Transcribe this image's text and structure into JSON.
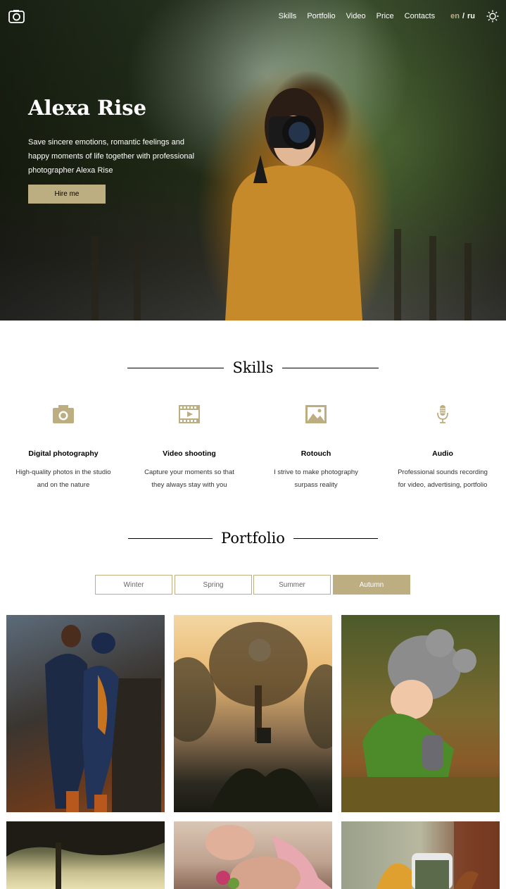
{
  "header": {
    "logo_icon": "camera-icon",
    "nav": [
      "Skills",
      "Portfolio",
      "Video",
      "Price",
      "Contacts"
    ],
    "lang_active": "en",
    "lang_sep": "/",
    "lang_other": "ru",
    "theme_icon": "sun-icon"
  },
  "hero": {
    "title": "Alexa Rise",
    "text": "Save sincere emotions, romantic feelings and happy moments of life together with professional photographer Alexa Rise",
    "button": "Hire me"
  },
  "skills": {
    "title": "Skills",
    "items": [
      {
        "icon": "camera-icon",
        "title": "Digital photography",
        "text": "High-quality photos in the studio and on the nature"
      },
      {
        "icon": "video-icon",
        "title": "Video shooting",
        "text": "Capture your moments so that they always stay with you"
      },
      {
        "icon": "image-icon",
        "title": "Rotouch",
        "text": "I strive to make photography surpass reality"
      },
      {
        "icon": "microphone-icon",
        "title": "Audio",
        "text": "Professional sounds recording for video, advertising, portfolio"
      }
    ]
  },
  "portfolio": {
    "title": "Portfolio",
    "seasons": [
      "Winter",
      "Spring",
      "Summer",
      "Autumn"
    ],
    "active_season": "Autumn"
  },
  "colors": {
    "accent": "#bdae82"
  }
}
